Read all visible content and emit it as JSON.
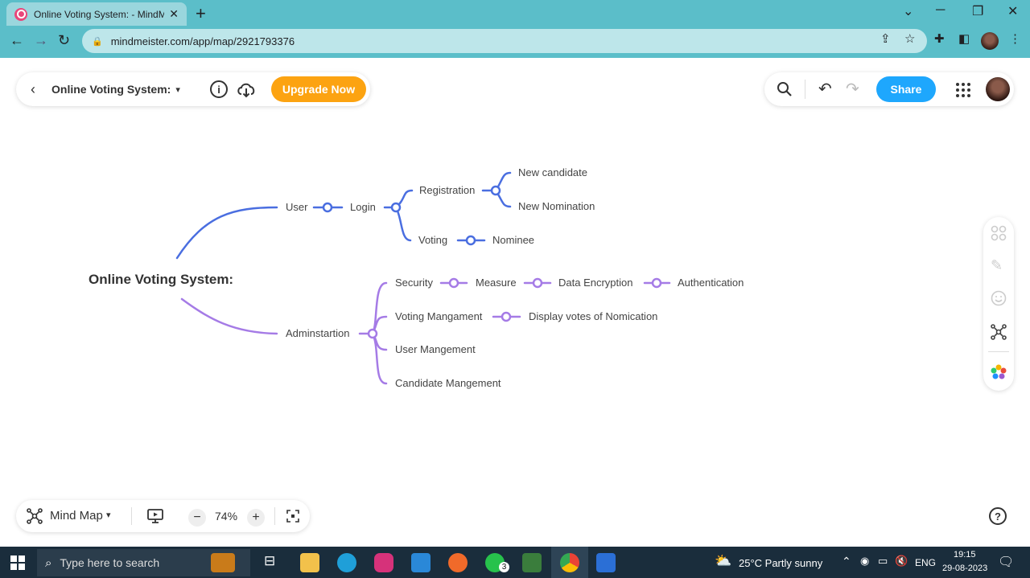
{
  "browser": {
    "tab_title": "Online Voting System: - MindMeister",
    "tab_close": "✕",
    "new_tab": "+",
    "url": "mindmeister.com/app/map/2921793376"
  },
  "app": {
    "map_title": "Online Voting System:",
    "upgrade_label": "Upgrade Now",
    "share_label": "Share",
    "view_mode": "Mind Map",
    "zoom_level": "74%",
    "zoom_out": "−",
    "zoom_in": "+",
    "info_icon": "i",
    "help_icon": "?"
  },
  "mindmap": {
    "root": "Online Voting System:",
    "branch_colors": {
      "user": "#4a6ee0",
      "admin": "#a57be6"
    },
    "user": "User",
    "login": "Login",
    "registration": "Registration",
    "new_candidate": "New candidate",
    "new_nomination": "New Nomination",
    "voting": "Voting",
    "nominee": "Nominee",
    "admin": "Adminstartion",
    "security": "Security",
    "measure": "Measure",
    "data_encryption": "Data Encryption",
    "authentication": "Authentication",
    "voting_mgmt": "Voting Mangament",
    "display_votes": "Display votes of Nomication",
    "user_mgmt": "User Mangement",
    "candidate_mgmt": "Candidate Mangement"
  },
  "taskbar": {
    "search_placeholder": "Type here to search",
    "whatsapp_badge": "3",
    "weather": "25°C  Partly sunny",
    "language": "ENG",
    "time": "19:15",
    "date": "29-08-2023"
  }
}
